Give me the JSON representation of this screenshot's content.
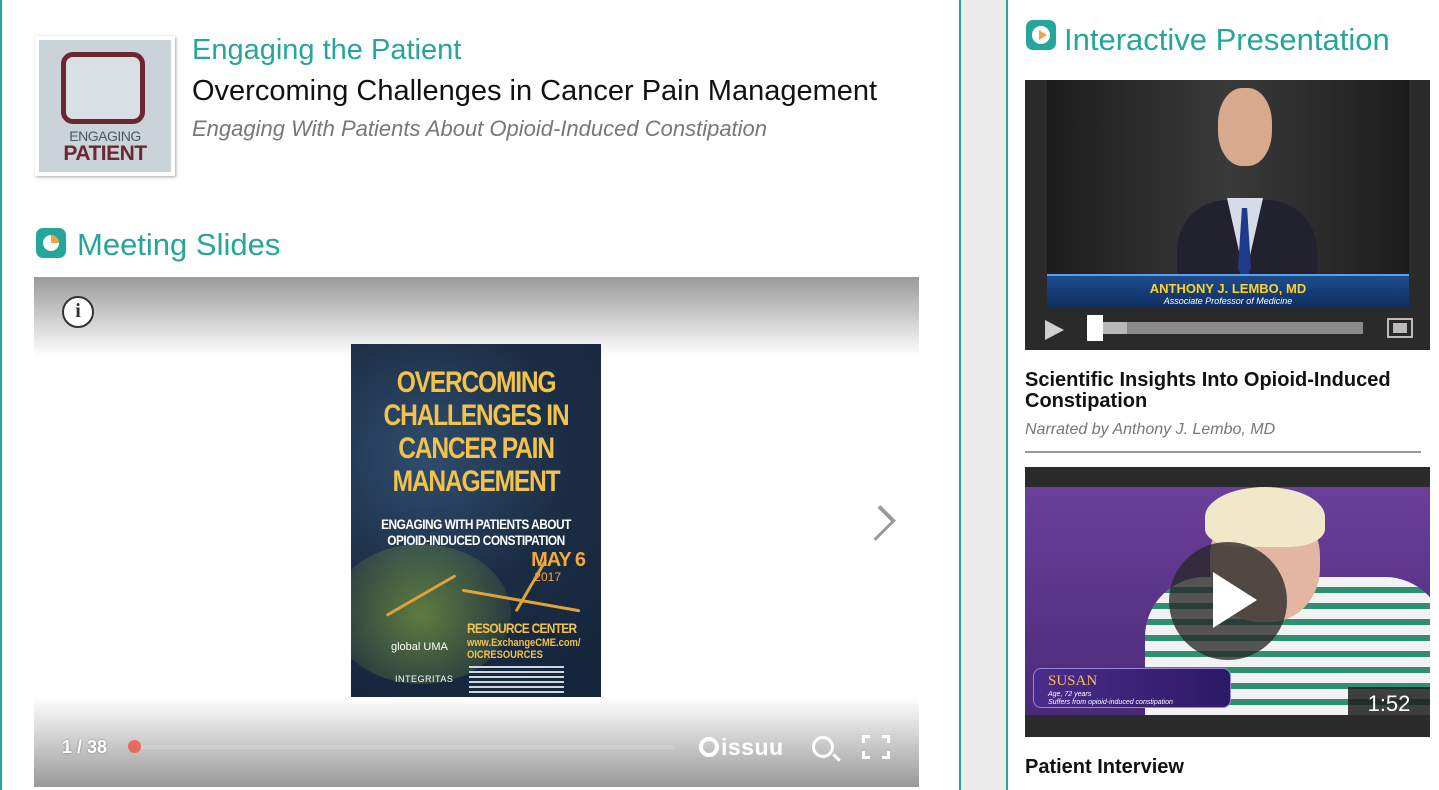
{
  "header": {
    "logo_word1": "ENGAGING",
    "logo_word2": "PATIENT",
    "series_title": "Engaging the Patient",
    "main_title": "Overcoming Challenges in Cancer Pain Management",
    "subtitle": "Engaging With Patients About Opioid-Induced Constipation"
  },
  "slides_section": {
    "heading": "Meeting Slides",
    "cover": {
      "title_lines": [
        "OVERCOMING",
        "CHALLENGES IN",
        "CANCER PAIN",
        "MANAGEMENT"
      ],
      "subtitle_lines": [
        "ENGAGING WITH PATIENTS ABOUT",
        "OPIOID-INDUCED CONSTIPATION"
      ],
      "date": "MAY 6",
      "year": "2017",
      "resource_label": "RESOURCE CENTER",
      "url_lines": [
        "www.ExchangeCME.com/",
        "OICRESOURCES"
      ],
      "sponsor1": "global UMA",
      "sponsor2": "INTEGRITAS"
    },
    "viewer": {
      "page_indicator": "1 / 38",
      "current_page": 1,
      "total_pages": 38,
      "brand": "issuu"
    }
  },
  "presentation_section": {
    "heading": "Interactive Presentation",
    "videos": [
      {
        "lower_third_name": "ANTHONY J. LEMBO, MD",
        "lower_third_role": "Associate Professor of Medicine",
        "title": "Scientific Insights Into Opioid-Induced Constipation",
        "narrator": "Narrated by Anthony J. Lembo, MD"
      },
      {
        "name_tag": "SUSAN",
        "name_tag_desc_lines": [
          "Age, 72 years",
          "Suffers from opioid-induced constipation"
        ],
        "duration": "1:52",
        "title": "Patient Interview"
      }
    ]
  },
  "colors": {
    "accent": "#26a69a",
    "progress_dot": "#e86a5c",
    "logo_maroon": "#6b2833"
  }
}
